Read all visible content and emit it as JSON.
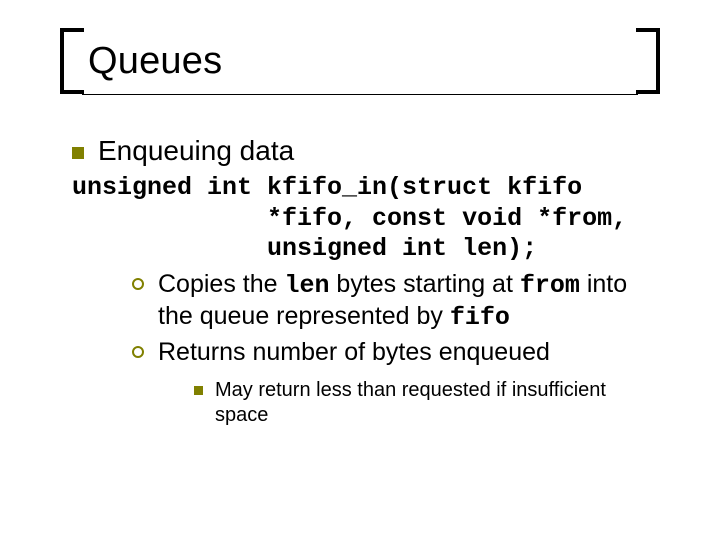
{
  "title": "Queues",
  "bullet1": "Enqueuing data",
  "func": {
    "line1": "unsigned int kfifo_in(struct kfifo",
    "line2": "             *fifo, const void *from,",
    "line3": "             unsigned int len);"
  },
  "sub": {
    "copies": {
      "t1": "Copies the ",
      "c1": "len",
      "t2": " bytes starting at ",
      "c2": "from",
      "t3": " into the queue represented by ",
      "c3": "fifo"
    },
    "returns": "Returns number of bytes enqueued"
  },
  "subsub": {
    "mayreturn": "May return less than requested if insufficient space"
  },
  "colors": {
    "accent": "#808000"
  }
}
